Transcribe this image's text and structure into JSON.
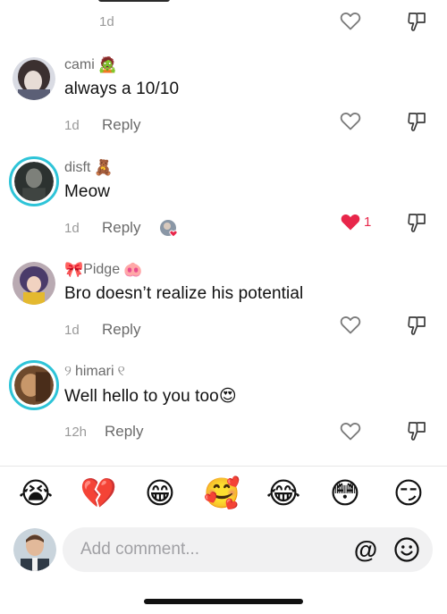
{
  "top": {
    "time": "1d"
  },
  "comments": [
    {
      "username": "cami",
      "user_emoji": "🧟",
      "text": "always a 10/10",
      "time": "1d",
      "reply_label": "Reply",
      "liked": false,
      "like_count": ""
    },
    {
      "username": "disft",
      "user_emoji": "🧸",
      "text": "Meow",
      "time": "1d",
      "reply_label": "Reply",
      "liked": true,
      "like_count": "1"
    },
    {
      "username": "Pidge",
      "user_emoji_before": "🎀",
      "user_emoji": "🐽",
      "text": "Bro doesn’t realize his potential",
      "time": "1d",
      "reply_label": "Reply",
      "liked": false,
      "like_count": ""
    },
    {
      "username": "himari",
      "decor_left": "୨",
      "decor_right": "୧",
      "text": "Well hello to you too",
      "text_emoji": "😍",
      "time": "12h",
      "reply_label": "Reply",
      "liked": false,
      "like_count": ""
    }
  ],
  "emoji_bar": [
    "😭",
    "💔",
    "😁",
    "🥰",
    "😂",
    "😳",
    "😏"
  ],
  "composer": {
    "placeholder": "Add comment...",
    "at_symbol": "@"
  },
  "colors": {
    "like_active": "#e8264a",
    "story_ring": "#2ec4d8",
    "muted": "#9a9a9a"
  }
}
